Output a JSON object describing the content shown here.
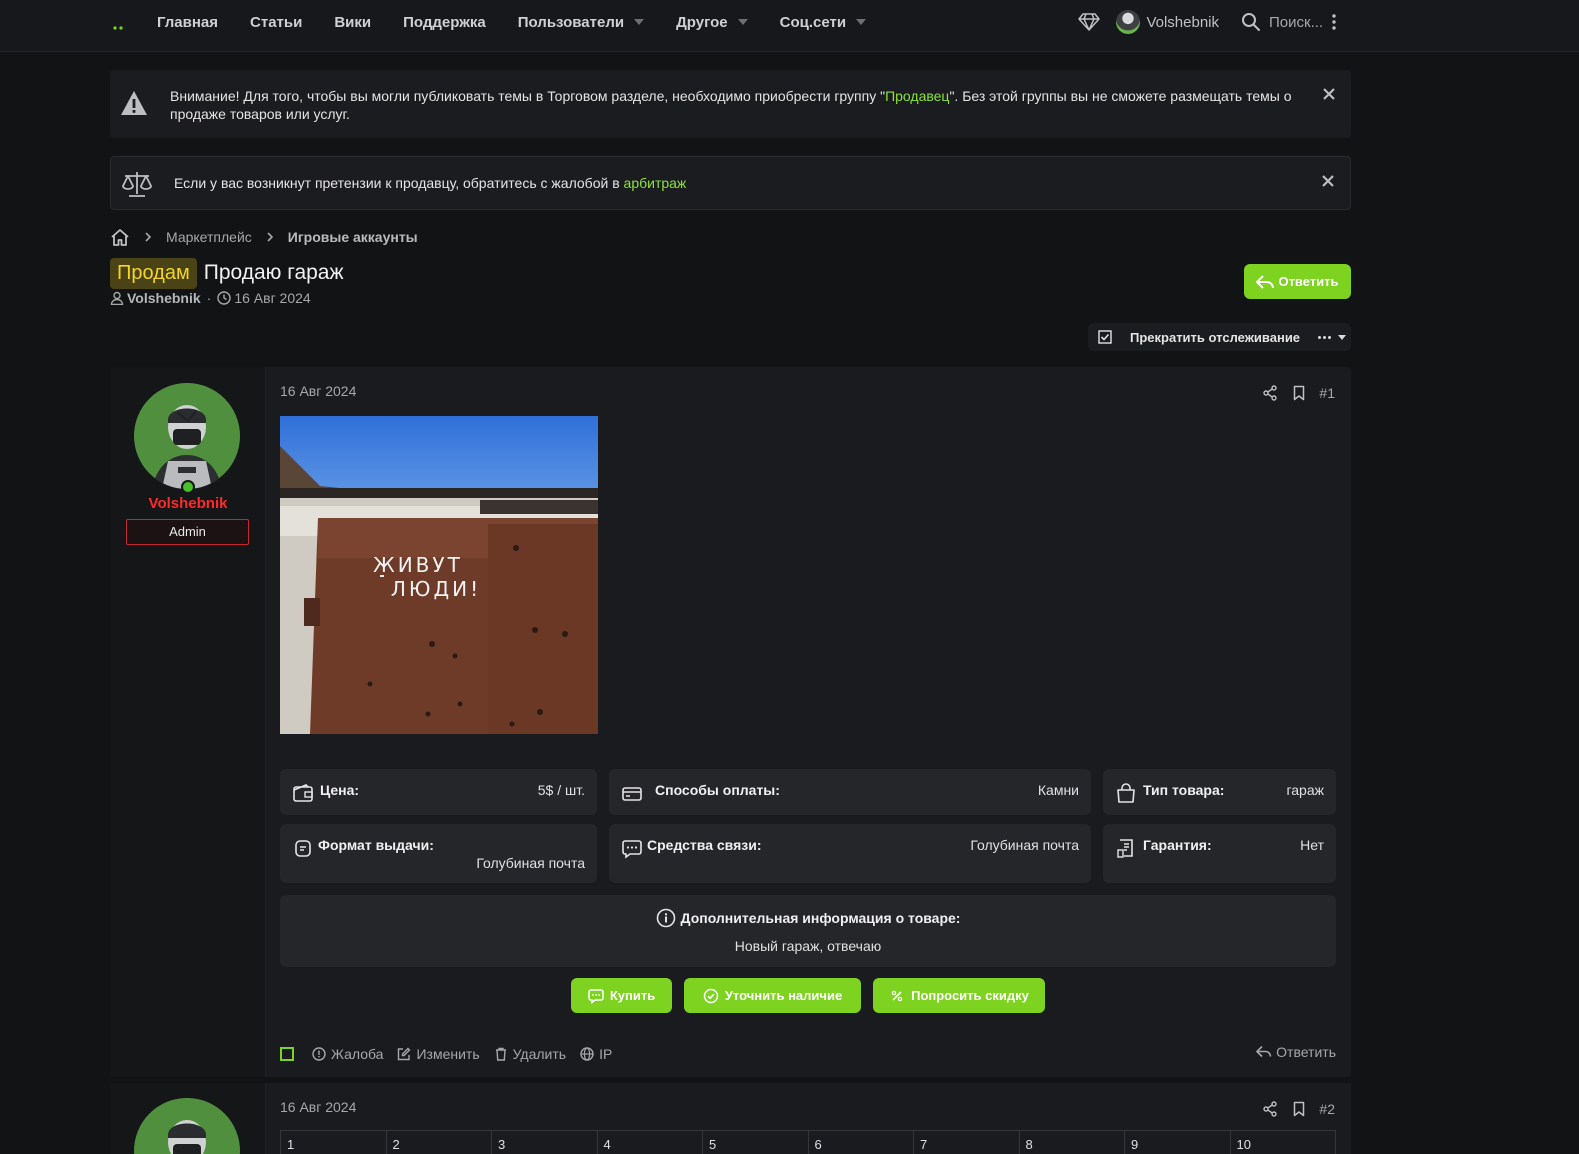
{
  "nav": {
    "items": [
      {
        "label": "Главная",
        "dropdown": false
      },
      {
        "label": "Статьи",
        "dropdown": false
      },
      {
        "label": "Вики",
        "dropdown": false
      },
      {
        "label": "Поддержка",
        "dropdown": false
      },
      {
        "label": "Пользователи",
        "dropdown": true
      },
      {
        "label": "Другое",
        "dropdown": true
      },
      {
        "label": "Соц.сети",
        "dropdown": true
      }
    ],
    "username": "Volshebnik",
    "search_placeholder": "Поиск..."
  },
  "notices": {
    "seller_pre": "Внимание! Для того, чтобы вы могли публиковать темы в Торговом разделе, необходимо приобрести группу \"",
    "seller_link": "Продавец",
    "seller_post": "\". Без этой группы вы не сможете размещать темы о продаже товаров или услуг.",
    "arb_pre": "Если у вас возникнут претензии к продавцу, обратитесь с жалобой в ",
    "arb_link": "арбитраж"
  },
  "breadcrumb": [
    "Маркетплейс",
    "Игровые аккаунты"
  ],
  "thread": {
    "prefix": "Продам",
    "title": "Продаю гараж",
    "author": "Volshebnik",
    "date": "16 Авг 2024",
    "reply_label": "Ответить",
    "watch_label": "Прекратить отслеживание"
  },
  "post": {
    "date": "16 Авг 2024",
    "number": "#1",
    "author": "Volshebnik",
    "badge": "Admin",
    "photo_text": [
      "ЖИВУТ",
      "ЛЮДИ!"
    ],
    "fields": {
      "price_label": "Цена:",
      "price_value": "5$ / шт.",
      "payment_label": "Способы оплаты:",
      "payment_value": "Камни",
      "type_label": "Тип товара:",
      "type_value": "гараж",
      "format_label": "Формат выдачи:",
      "format_value": "Голубиная почта",
      "contact_label": "Средства связи:",
      "contact_value": "Голубиная почта",
      "warranty_label": "Гарантия:",
      "warranty_value": "Нет"
    },
    "extra_label": "Дополнительная информация о товаре:",
    "extra_value": "Новый гараж, отвечаю",
    "actions": {
      "buy": "Купить",
      "check": "Уточнить наличие",
      "discount": "Попросить скидку"
    },
    "footer": {
      "report": "Жалоба",
      "edit": "Изменить",
      "delete": "Удалить",
      "ip": "IP",
      "reply": "Ответить"
    }
  },
  "post2": {
    "date": "16 Авг 2024",
    "number": "#2",
    "table_headers": [
      "1",
      "2",
      "3",
      "4",
      "5",
      "6",
      "7",
      "8",
      "9",
      "10"
    ]
  },
  "colors": {
    "accent": "#7ed321",
    "username_admin": "#ff2a2a",
    "prefix_bg": "#4a4316",
    "prefix_fg": "#f5d52a"
  }
}
